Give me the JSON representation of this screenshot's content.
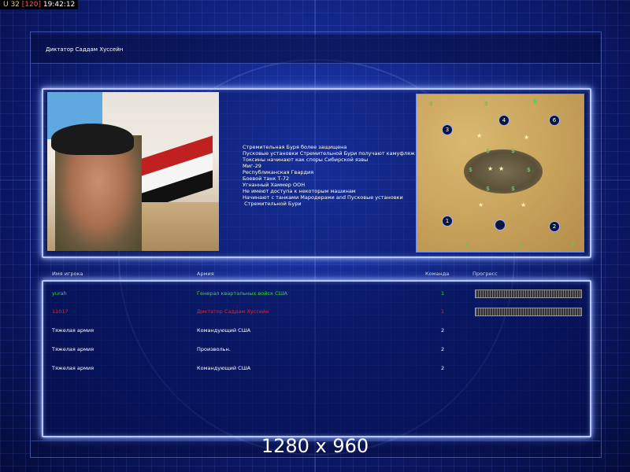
{
  "status_bar": {
    "part_a": "U 32",
    "part_b": "[120]",
    "part_c": "19:42:12"
  },
  "title": "Диктатор Саддам Хуссейн",
  "briefing_lines": [
    "Стремительная Буря более защищена",
    "Пусковые установки Стремительной Бури получают камуфляж",
    "Токсины начинают как споры Сибирской язвы",
    "Миг-29",
    "Республиканская Гвардия",
    "Боевой танк Т-72",
    "Угнанный Хаммер ООН",
    "Не имеют доступа к некоторым машинам",
    "Начинают с танками Мародерами and Пусковые установки",
    " Стремительной Бури"
  ],
  "map": {
    "spots": [
      "3",
      "4",
      "6",
      "1",
      "",
      "2"
    ]
  },
  "columns": {
    "player": "Имя игрока",
    "army": "Армия",
    "team": "Команда",
    "progress": "Прогресс"
  },
  "players": [
    {
      "name": "yurah",
      "army": "Генерал квартальных войск США",
      "team": "1",
      "color": "#33dd33",
      "progress": 1.0
    },
    {
      "name": "11017",
      "army": "Диктатор Саддам Хуссейн",
      "team": "1",
      "color": "#ee2222",
      "progress": 1.0
    },
    {
      "name": "Тяжелая армия",
      "army": "Командующий США",
      "team": "2",
      "color": "#ffffff"
    },
    {
      "name": "Тяжелая армия",
      "army": "Произвольн.",
      "team": "2",
      "color": "#ffffff"
    },
    {
      "name": "Тяжелая армия",
      "army": "Командующий США",
      "team": "2",
      "color": "#ffffff"
    }
  ],
  "watermark": "1280 x 960"
}
